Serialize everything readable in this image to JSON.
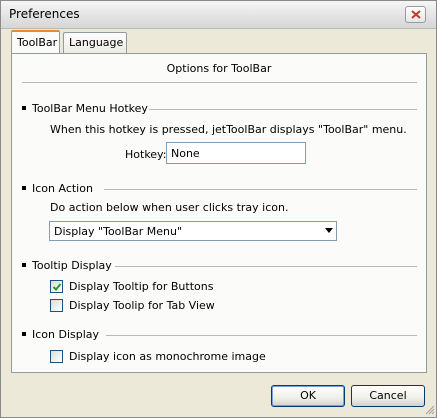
{
  "window": {
    "title": "Preferences"
  },
  "tabs": [
    {
      "label": "ToolBar",
      "active": true
    },
    {
      "label": "Language",
      "active": false
    }
  ],
  "panel": {
    "heading": "Options for ToolBar",
    "hotkey_section": {
      "title": "ToolBar Menu Hotkey",
      "description": "When this hotkey is pressed, jetToolBar displays \"ToolBar\" menu.",
      "hotkey_label": "Hotkey:",
      "hotkey_value": "None"
    },
    "icon_action_section": {
      "title": "Icon Action",
      "description": "Do action below when user clicks tray icon.",
      "selected_action": "Display \"ToolBar Menu\""
    },
    "tooltip_section": {
      "title": "Tooltip Display",
      "options": [
        {
          "label": "Display Tooltip for Buttons",
          "checked": true
        },
        {
          "label": "Display Toolip for Tab View",
          "checked": false
        }
      ]
    },
    "icon_display_section": {
      "title": "Icon Display",
      "options": [
        {
          "label": "Display icon as monochrome image",
          "checked": false
        }
      ]
    }
  },
  "buttons": {
    "ok": "OK",
    "cancel": "Cancel"
  },
  "colors": {
    "dialog_bg": "#ece9d8",
    "panel_bg": "#fbfbf9",
    "active_tab_accent": "#e68b2c",
    "button_border": "#003c74"
  }
}
